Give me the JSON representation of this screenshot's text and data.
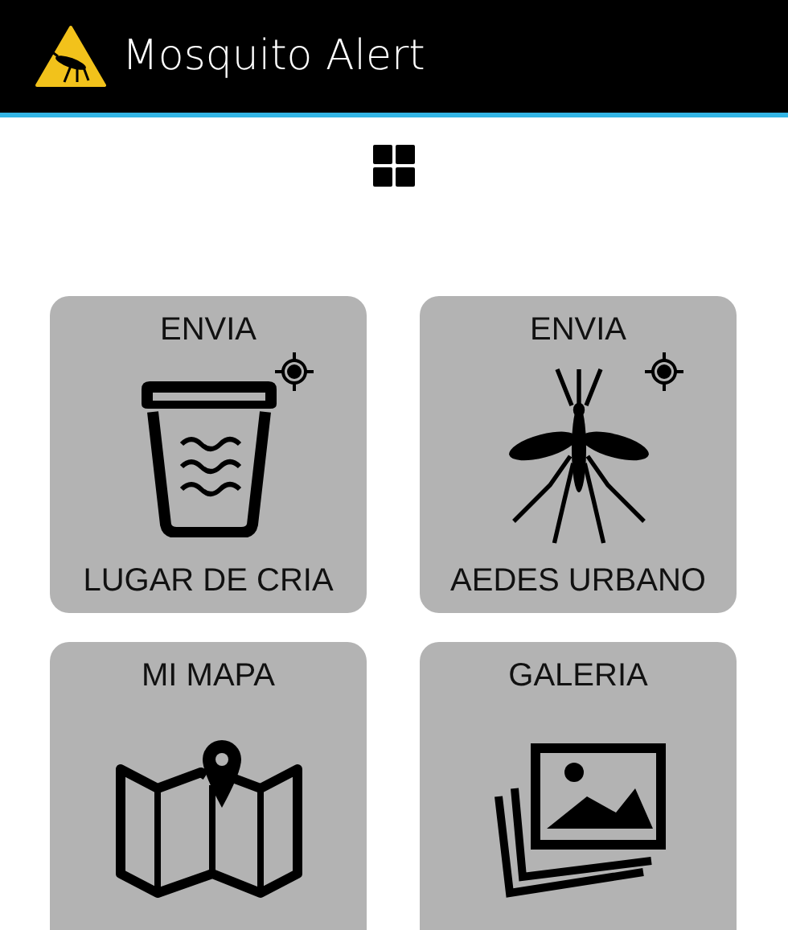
{
  "app_bar": {
    "title": "Mosquito Alert"
  },
  "tiles": [
    {
      "kind": "breeding-site",
      "top_label": "ENVIA",
      "bottom_label": "LUGAR DE CRIA",
      "gps": true
    },
    {
      "kind": "mosquito",
      "top_label": "ENVIA",
      "bottom_label": "AEDES URBANO",
      "gps": true
    },
    {
      "kind": "map",
      "top_label": "MI MAPA",
      "gps": false
    },
    {
      "kind": "gallery",
      "top_label": "GALERIA",
      "gps": false
    }
  ]
}
